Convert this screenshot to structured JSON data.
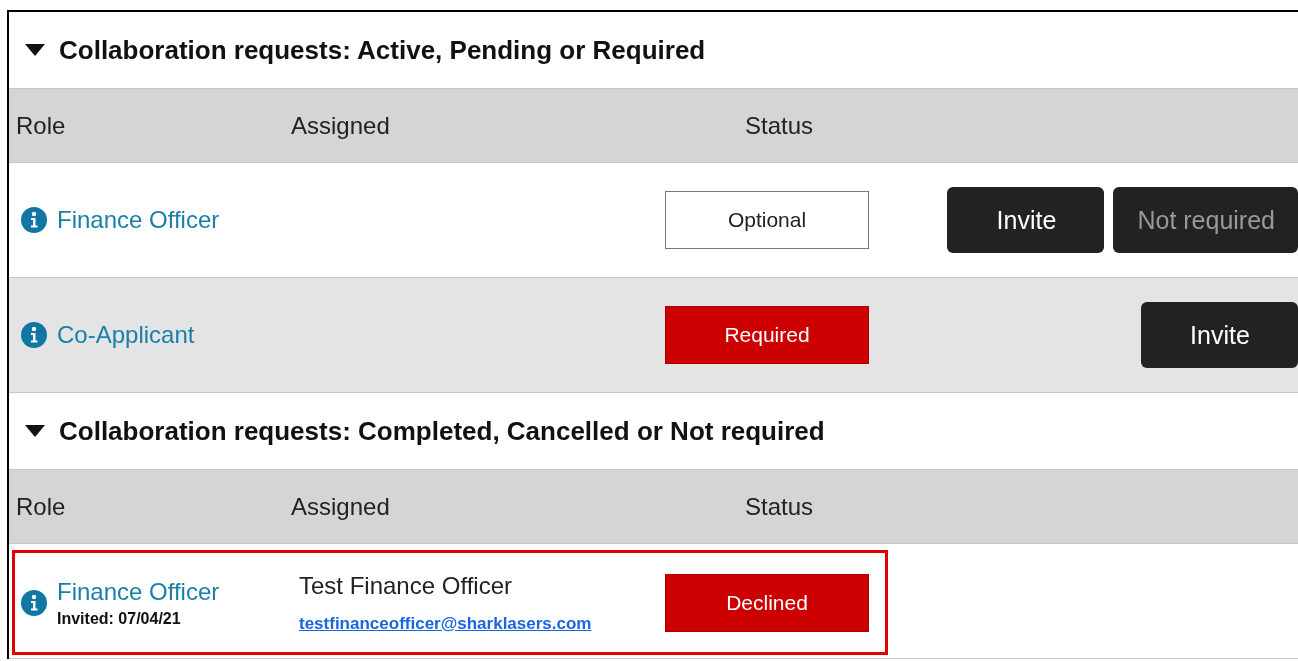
{
  "sections": [
    {
      "title": "Collaboration requests: Active, Pending or Required",
      "expanded": true,
      "columns": [
        "Role",
        "Assigned",
        "Status"
      ],
      "rows": [
        {
          "role": "Finance Officer",
          "status": {
            "label": "Optional",
            "kind": "optional"
          },
          "highlighted": false,
          "shaded": false,
          "actions": [
            {
              "label": "Invite",
              "disabled": false
            },
            {
              "label": "Not required",
              "disabled": true
            }
          ]
        },
        {
          "role": "Co-Applicant",
          "status": {
            "label": "Required",
            "kind": "alert"
          },
          "highlighted": false,
          "shaded": true,
          "actions": [
            {
              "label": "Invite",
              "disabled": false
            }
          ]
        }
      ]
    },
    {
      "title": "Collaboration requests: Completed, Cancelled or Not required",
      "expanded": true,
      "columns": [
        "Role",
        "Assigned",
        "Status"
      ],
      "rows": [
        {
          "role": "Finance Officer",
          "invited": "Invited: 07/04/21",
          "assignee": "Test Finance Officer",
          "email": "testfinanceofficer@sharklasers.com",
          "status": {
            "label": "Declined",
            "kind": "alert"
          },
          "highlighted": true,
          "shaded": false
        }
      ]
    }
  ]
}
